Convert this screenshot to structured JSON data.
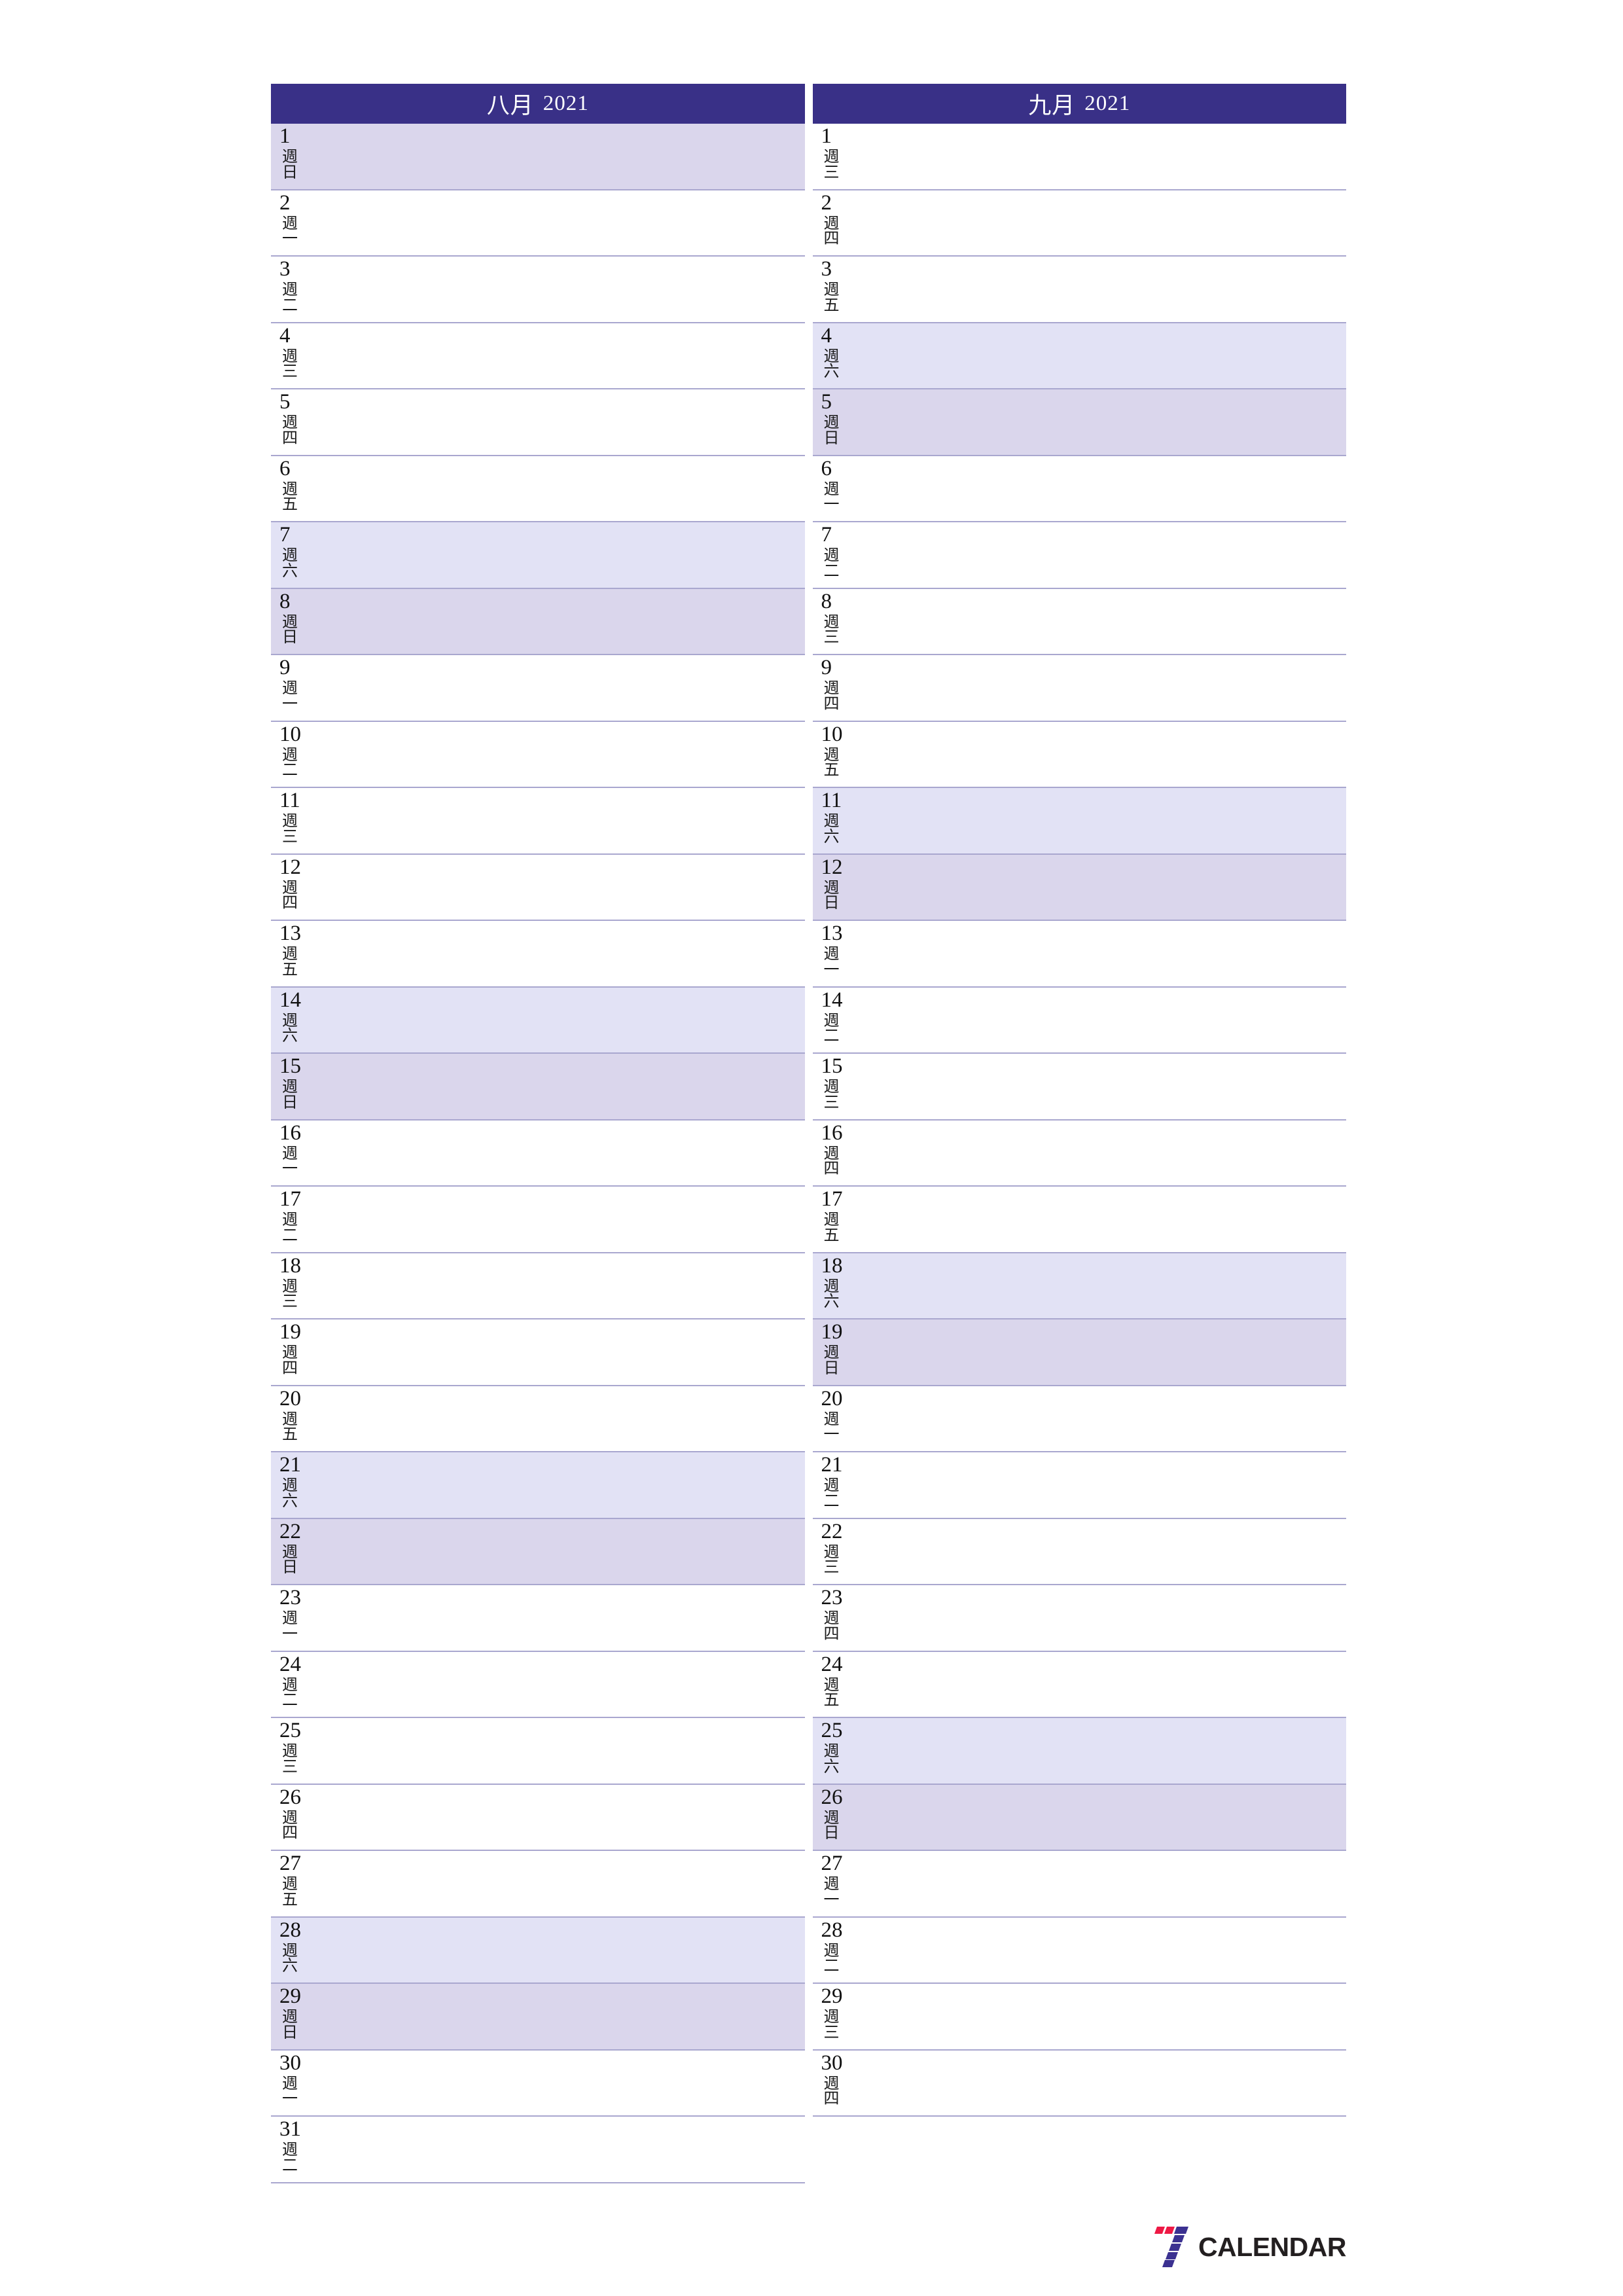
{
  "document": {
    "type": "two-month-planner",
    "year": "2021",
    "logo": {
      "mark_name": "seven-logo-mark",
      "text": "CALENDAR",
      "colors": {
        "red": "#ee1945",
        "indigo": "#3b3191",
        "text": "#231f20"
      }
    }
  },
  "theme": {
    "header_bg": "#393087",
    "header_text": "#ffffff",
    "saturday_bg": "#e2e2f5",
    "sunday_bg": "#dad6ec",
    "row_border": "#a9a7cf",
    "page_bg": "#ffffff",
    "day_text": "#111111"
  },
  "weekday_labels": {
    "sun": {
      "l1": "週",
      "l2": "日"
    },
    "mon": {
      "l1": "週",
      "l2": "一"
    },
    "tue": {
      "l1": "週",
      "l2": "二"
    },
    "wed": {
      "l1": "週",
      "l2": "三"
    },
    "thu": {
      "l1": "週",
      "l2": "四"
    },
    "fri": {
      "l1": "週",
      "l2": "五"
    },
    "sat": {
      "l1": "週",
      "l2": "六"
    }
  },
  "months": [
    {
      "key": "august",
      "name": "八月",
      "year": "2021",
      "num_days": 31,
      "first_weekday": "sun",
      "days": [
        {
          "num": "1",
          "wd": "sun",
          "l1": "週",
          "l2": "日",
          "type": "sun"
        },
        {
          "num": "2",
          "wd": "mon",
          "l1": "週",
          "l2": "一",
          "type": "weekday"
        },
        {
          "num": "3",
          "wd": "tue",
          "l1": "週",
          "l2": "二",
          "type": "weekday"
        },
        {
          "num": "4",
          "wd": "wed",
          "l1": "週",
          "l2": "三",
          "type": "weekday"
        },
        {
          "num": "5",
          "wd": "thu",
          "l1": "週",
          "l2": "四",
          "type": "weekday"
        },
        {
          "num": "6",
          "wd": "fri",
          "l1": "週",
          "l2": "五",
          "type": "weekday"
        },
        {
          "num": "7",
          "wd": "sat",
          "l1": "週",
          "l2": "六",
          "type": "sat"
        },
        {
          "num": "8",
          "wd": "sun",
          "l1": "週",
          "l2": "日",
          "type": "sun"
        },
        {
          "num": "9",
          "wd": "mon",
          "l1": "週",
          "l2": "一",
          "type": "weekday"
        },
        {
          "num": "10",
          "wd": "tue",
          "l1": "週",
          "l2": "二",
          "type": "weekday"
        },
        {
          "num": "11",
          "wd": "wed",
          "l1": "週",
          "l2": "三",
          "type": "weekday"
        },
        {
          "num": "12",
          "wd": "thu",
          "l1": "週",
          "l2": "四",
          "type": "weekday"
        },
        {
          "num": "13",
          "wd": "fri",
          "l1": "週",
          "l2": "五",
          "type": "weekday"
        },
        {
          "num": "14",
          "wd": "sat",
          "l1": "週",
          "l2": "六",
          "type": "sat"
        },
        {
          "num": "15",
          "wd": "sun",
          "l1": "週",
          "l2": "日",
          "type": "sun"
        },
        {
          "num": "16",
          "wd": "mon",
          "l1": "週",
          "l2": "一",
          "type": "weekday"
        },
        {
          "num": "17",
          "wd": "tue",
          "l1": "週",
          "l2": "二",
          "type": "weekday"
        },
        {
          "num": "18",
          "wd": "wed",
          "l1": "週",
          "l2": "三",
          "type": "weekday"
        },
        {
          "num": "19",
          "wd": "thu",
          "l1": "週",
          "l2": "四",
          "type": "weekday"
        },
        {
          "num": "20",
          "wd": "fri",
          "l1": "週",
          "l2": "五",
          "type": "weekday"
        },
        {
          "num": "21",
          "wd": "sat",
          "l1": "週",
          "l2": "六",
          "type": "sat"
        },
        {
          "num": "22",
          "wd": "sun",
          "l1": "週",
          "l2": "日",
          "type": "sun"
        },
        {
          "num": "23",
          "wd": "mon",
          "l1": "週",
          "l2": "一",
          "type": "weekday"
        },
        {
          "num": "24",
          "wd": "tue",
          "l1": "週",
          "l2": "二",
          "type": "weekday"
        },
        {
          "num": "25",
          "wd": "wed",
          "l1": "週",
          "l2": "三",
          "type": "weekday"
        },
        {
          "num": "26",
          "wd": "thu",
          "l1": "週",
          "l2": "四",
          "type": "weekday"
        },
        {
          "num": "27",
          "wd": "fri",
          "l1": "週",
          "l2": "五",
          "type": "weekday"
        },
        {
          "num": "28",
          "wd": "sat",
          "l1": "週",
          "l2": "六",
          "type": "sat"
        },
        {
          "num": "29",
          "wd": "sun",
          "l1": "週",
          "l2": "日",
          "type": "sun"
        },
        {
          "num": "30",
          "wd": "mon",
          "l1": "週",
          "l2": "一",
          "type": "weekday"
        },
        {
          "num": "31",
          "wd": "tue",
          "l1": "週",
          "l2": "二",
          "type": "weekday"
        }
      ]
    },
    {
      "key": "september",
      "name": "九月",
      "year": "2021",
      "num_days": 30,
      "first_weekday": "wed",
      "days": [
        {
          "num": "1",
          "wd": "wed",
          "l1": "週",
          "l2": "三",
          "type": "weekday"
        },
        {
          "num": "2",
          "wd": "thu",
          "l1": "週",
          "l2": "四",
          "type": "weekday"
        },
        {
          "num": "3",
          "wd": "fri",
          "l1": "週",
          "l2": "五",
          "type": "weekday"
        },
        {
          "num": "4",
          "wd": "sat",
          "l1": "週",
          "l2": "六",
          "type": "sat"
        },
        {
          "num": "5",
          "wd": "sun",
          "l1": "週",
          "l2": "日",
          "type": "sun"
        },
        {
          "num": "6",
          "wd": "mon",
          "l1": "週",
          "l2": "一",
          "type": "weekday"
        },
        {
          "num": "7",
          "wd": "tue",
          "l1": "週",
          "l2": "二",
          "type": "weekday"
        },
        {
          "num": "8",
          "wd": "wed",
          "l1": "週",
          "l2": "三",
          "type": "weekday"
        },
        {
          "num": "9",
          "wd": "thu",
          "l1": "週",
          "l2": "四",
          "type": "weekday"
        },
        {
          "num": "10",
          "wd": "fri",
          "l1": "週",
          "l2": "五",
          "type": "weekday"
        },
        {
          "num": "11",
          "wd": "sat",
          "l1": "週",
          "l2": "六",
          "type": "sat"
        },
        {
          "num": "12",
          "wd": "sun",
          "l1": "週",
          "l2": "日",
          "type": "sun"
        },
        {
          "num": "13",
          "wd": "mon",
          "l1": "週",
          "l2": "一",
          "type": "weekday"
        },
        {
          "num": "14",
          "wd": "tue",
          "l1": "週",
          "l2": "二",
          "type": "weekday"
        },
        {
          "num": "15",
          "wd": "wed",
          "l1": "週",
          "l2": "三",
          "type": "weekday"
        },
        {
          "num": "16",
          "wd": "thu",
          "l1": "週",
          "l2": "四",
          "type": "weekday"
        },
        {
          "num": "17",
          "wd": "fri",
          "l1": "週",
          "l2": "五",
          "type": "weekday"
        },
        {
          "num": "18",
          "wd": "sat",
          "l1": "週",
          "l2": "六",
          "type": "sat"
        },
        {
          "num": "19",
          "wd": "sun",
          "l1": "週",
          "l2": "日",
          "type": "sun"
        },
        {
          "num": "20",
          "wd": "mon",
          "l1": "週",
          "l2": "一",
          "type": "weekday"
        },
        {
          "num": "21",
          "wd": "tue",
          "l1": "週",
          "l2": "二",
          "type": "weekday"
        },
        {
          "num": "22",
          "wd": "wed",
          "l1": "週",
          "l2": "三",
          "type": "weekday"
        },
        {
          "num": "23",
          "wd": "thu",
          "l1": "週",
          "l2": "四",
          "type": "weekday"
        },
        {
          "num": "24",
          "wd": "fri",
          "l1": "週",
          "l2": "五",
          "type": "weekday"
        },
        {
          "num": "25",
          "wd": "sat",
          "l1": "週",
          "l2": "六",
          "type": "sat"
        },
        {
          "num": "26",
          "wd": "sun",
          "l1": "週",
          "l2": "日",
          "type": "sun"
        },
        {
          "num": "27",
          "wd": "mon",
          "l1": "週",
          "l2": "一",
          "type": "weekday"
        },
        {
          "num": "28",
          "wd": "tue",
          "l1": "週",
          "l2": "二",
          "type": "weekday"
        },
        {
          "num": "29",
          "wd": "wed",
          "l1": "週",
          "l2": "三",
          "type": "weekday"
        },
        {
          "num": "30",
          "wd": "thu",
          "l1": "週",
          "l2": "四",
          "type": "weekday"
        }
      ]
    }
  ]
}
